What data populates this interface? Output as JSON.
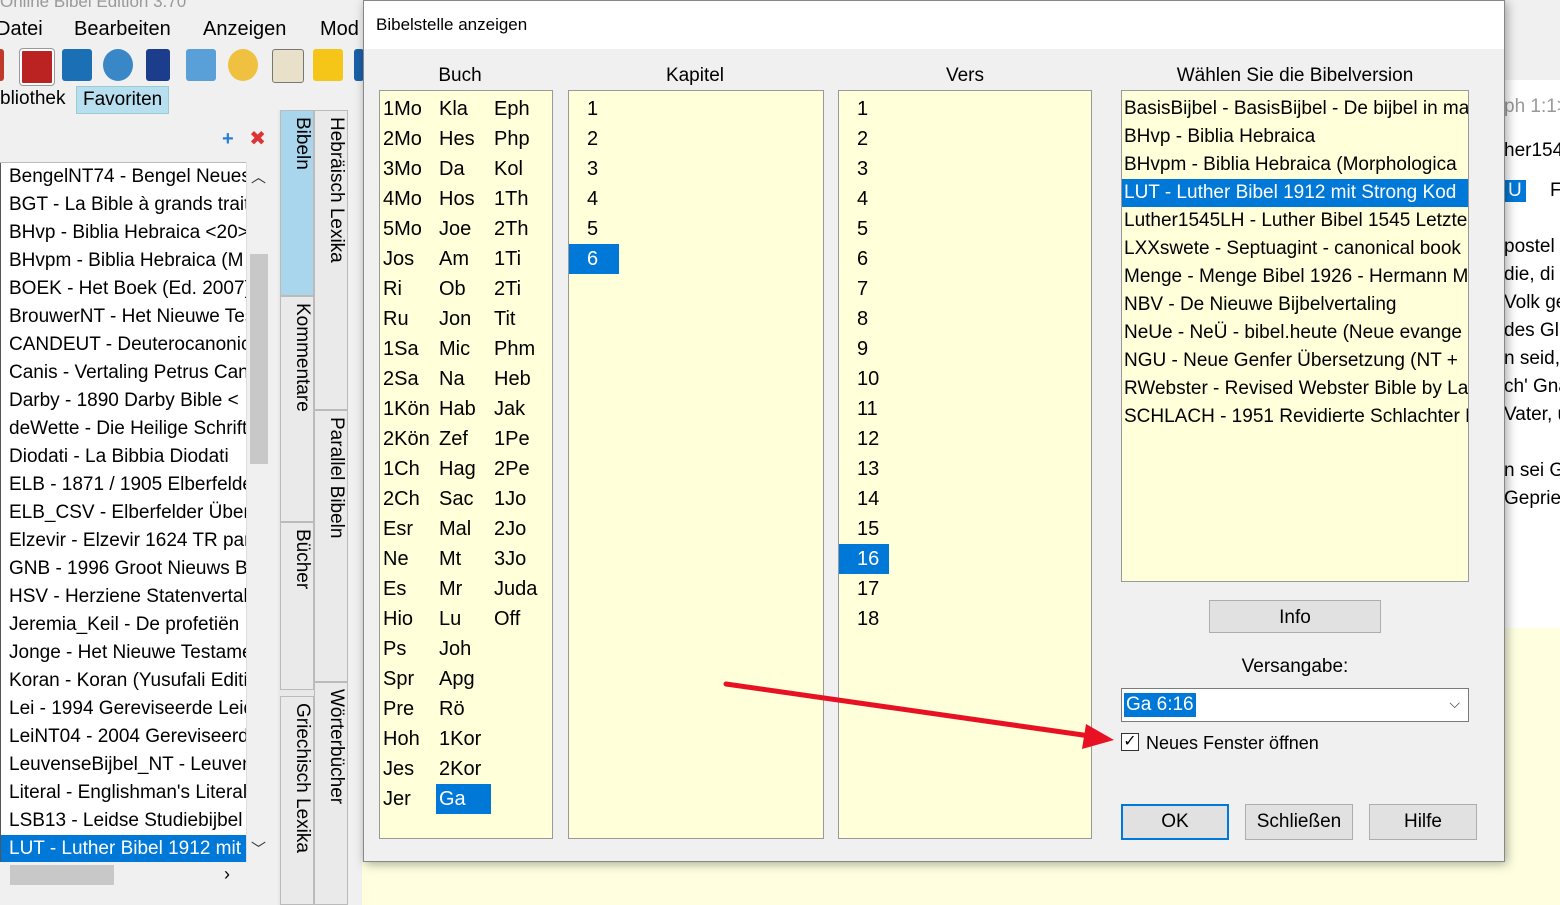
{
  "main_window": {
    "title": "Online Bibel Edition 3.70",
    "menu": [
      "Datei",
      "Bearbeiten",
      "Anzeigen",
      "Mod"
    ],
    "library_tabs": [
      "bliothek",
      "Favoriten"
    ],
    "bible_list": [
      "BengelNT74 - Bengel Neues Testament",
      "BGT - La Bible à grands traits",
      "BHvp - Biblia Hebraica <20>",
      "BHvpm - Biblia Hebraica (M",
      "BOEK - Het Boek (Ed. 2007)",
      "BrouwerNT - Het Nieuwe Testament",
      "CANDEUT - Deuterocanonical",
      "Canis - Vertaling Petrus Canisius",
      "Darby - 1890 Darby Bible <",
      "deWette - Die Heilige Schrift",
      "Diodati - La Bibbia Diodati",
      "ELB - 1871 / 1905 Elberfelder",
      "ELB_CSV - Elberfelder Übersetzung",
      "Elzevir - Elzevir 1624 TR par",
      "GNB - 1996 Groot Nieuws Bijbel",
      "HSV - Herziene Statenvertaling",
      "Jeremia_Keil - De profetiën",
      "Jonge - Het Nieuwe Testament",
      "Koran - Koran (Yusufali Edition",
      "Lei - 1994 Gereviseerde Leidse",
      "LeiNT04 - 2004 Gereviseerde",
      "LeuvenseBijbel_NT - Leuvense",
      "Literal - Englishman's Literal",
      "LSB13 - Leidse Studiebijbel",
      "LUT - Luther Bibel 1912 mit"
    ],
    "selected_bible_index": 24,
    "vertical_tabs_left": [
      "Bibeln",
      "Kommentare",
      "Bücher",
      "Griechisch Lexika"
    ],
    "vertical_tabs_right": [
      "Hebräisch Lexika",
      "Parallel Bibeln",
      "Wörterbücher"
    ],
    "right_snippets": [
      "ph 1:1>",
      "her154",
      "U",
      "F",
      "postel",
      "die, di",
      "Volk ge",
      "des Gl",
      "n seid,",
      "ch' Gna",
      "Vater, u",
      "n sei Go",
      "Gepries"
    ]
  },
  "dialog": {
    "title": "Bibelstelle anzeigen",
    "headers": {
      "book": "Buch",
      "chapter": "Kapitel",
      "verse": "Vers",
      "version": "Wählen Sie die Bibelversion"
    },
    "books": [
      [
        "1Mo",
        "Kla",
        "Eph"
      ],
      [
        "2Mo",
        "Hes",
        "Php"
      ],
      [
        "3Mo",
        "Da",
        "Kol"
      ],
      [
        "4Mo",
        "Hos",
        "1Th"
      ],
      [
        "5Mo",
        "Joe",
        "2Th"
      ],
      [
        "Jos",
        "Am",
        "1Ti"
      ],
      [
        "Ri",
        "Ob",
        "2Ti"
      ],
      [
        "Ru",
        "Jon",
        "Tit"
      ],
      [
        "1Sa",
        "Mic",
        "Phm"
      ],
      [
        "2Sa",
        "Na",
        "Heb"
      ],
      [
        "1Kön",
        "Hab",
        "Jak"
      ],
      [
        "2Kön",
        "Zef",
        "1Pe"
      ],
      [
        "1Ch",
        "Hag",
        "2Pe"
      ],
      [
        "2Ch",
        "Sac",
        "1Jo"
      ],
      [
        "Esr",
        "Mal",
        "2Jo"
      ],
      [
        "Ne",
        "Mt",
        "3Jo"
      ],
      [
        "Es",
        "Mr",
        "Juda"
      ],
      [
        "Hio",
        "Lu",
        "Off"
      ],
      [
        "Ps",
        "Joh",
        ""
      ],
      [
        "Spr",
        "Apg",
        ""
      ],
      [
        "Pre",
        "Rö",
        ""
      ],
      [
        "Hoh",
        "1Kor",
        ""
      ],
      [
        "Jes",
        "2Kor",
        ""
      ],
      [
        "Jer",
        "Ga",
        ""
      ]
    ],
    "selected_book": "Ga",
    "chapters": [
      "1",
      "2",
      "3",
      "4",
      "5",
      "6"
    ],
    "selected_chapter": "6",
    "verses": [
      "1",
      "2",
      "3",
      "4",
      "5",
      "6",
      "7",
      "8",
      "9",
      "10",
      "11",
      "12",
      "13",
      "14",
      "15",
      "16",
      "17",
      "18"
    ],
    "selected_verse": "16",
    "versions": [
      "BasisBijbel - BasisBijbel - De bijbel in ma",
      "BHvp - Biblia Hebraica",
      "BHvpm - Biblia Hebraica (Morphologica",
      "LUT - Luther Bibel 1912 mit Strong Kod",
      "Luther1545LH - Luther Bibel 1545 Letzte",
      "LXXswete - Septuagint - canonical book",
      "Menge - Menge Bibel 1926 - Hermann M",
      "NBV - De Nieuwe Bijbelvertaling",
      "NeUe - NeÜ - bibel.heute (Neue evange",
      "NGU - Neue Genfer Übersetzung (NT +",
      "RWebster - Revised Webster Bible by La",
      "SCHLACH - 1951 Revidierte Schlachter B"
    ],
    "selected_version_index": 3,
    "info_button": "Info",
    "reference_label": "Versangabe:",
    "reference_value": "Ga 6:16",
    "new_window_label": "Neues Fenster öffnen",
    "new_window_checked": true,
    "ok_button": "OK",
    "close_button": "Schließen",
    "help_button": "Hilfe"
  },
  "annotation": {
    "arrow_color": "#e81123"
  }
}
